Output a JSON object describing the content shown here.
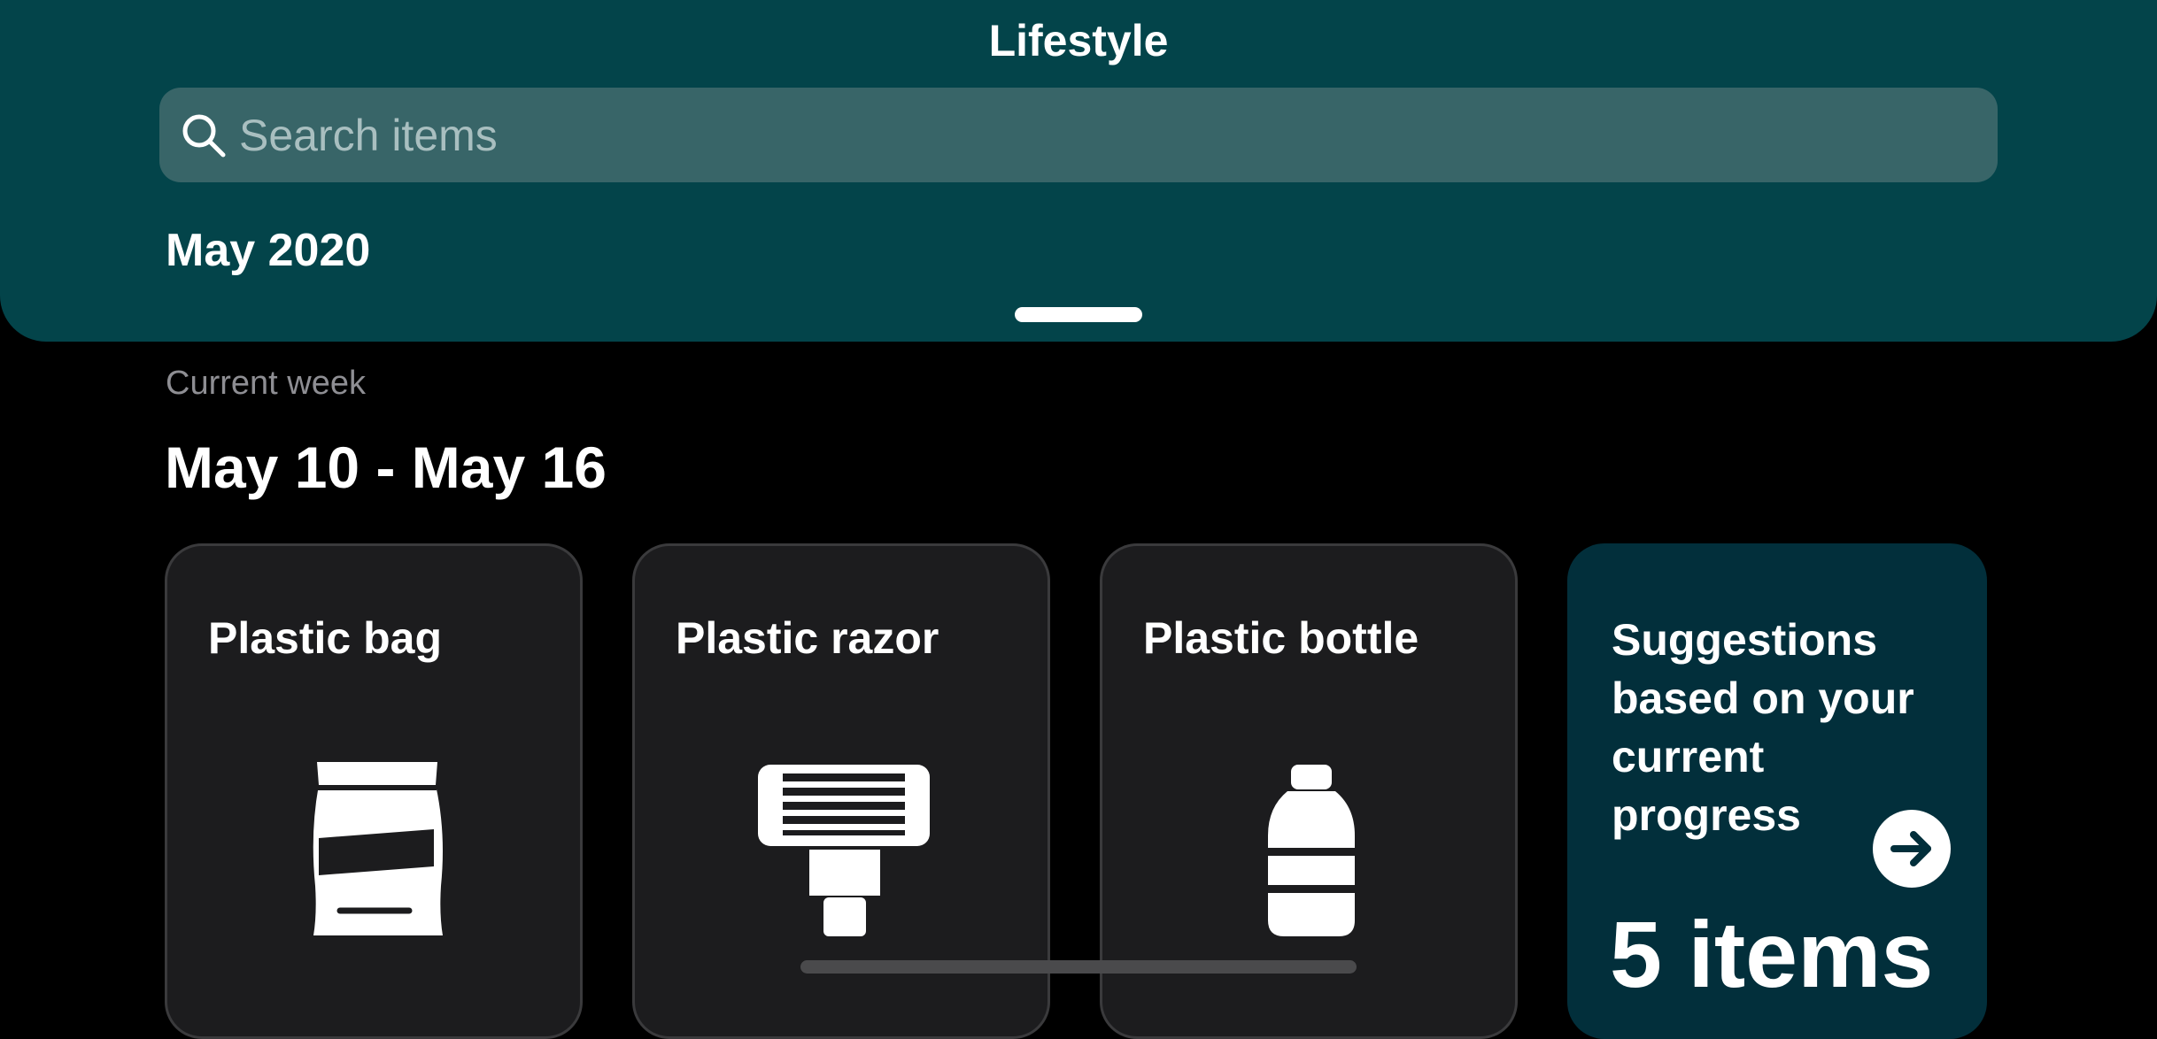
{
  "header": {
    "title": "Lifestyle",
    "search_placeholder": "Search items",
    "month": "May 2020"
  },
  "week": {
    "label": "Current week",
    "range": "May 10 - May 16"
  },
  "items": [
    {
      "title": "Plastic bag",
      "icon": "plastic-bag-icon"
    },
    {
      "title": "Plastic razor",
      "icon": "razor-icon"
    },
    {
      "title": "Plastic bottle",
      "icon": "bottle-icon"
    }
  ],
  "suggestions": {
    "text": "Suggestions based on your current progress",
    "count": "5 items",
    "icon": "arrow-right-icon"
  },
  "colors": {
    "header_bg": "#03444a",
    "search_bg": "#386568",
    "card_bg": "#1c1c1e",
    "suggest_bg": "#022f3b"
  }
}
